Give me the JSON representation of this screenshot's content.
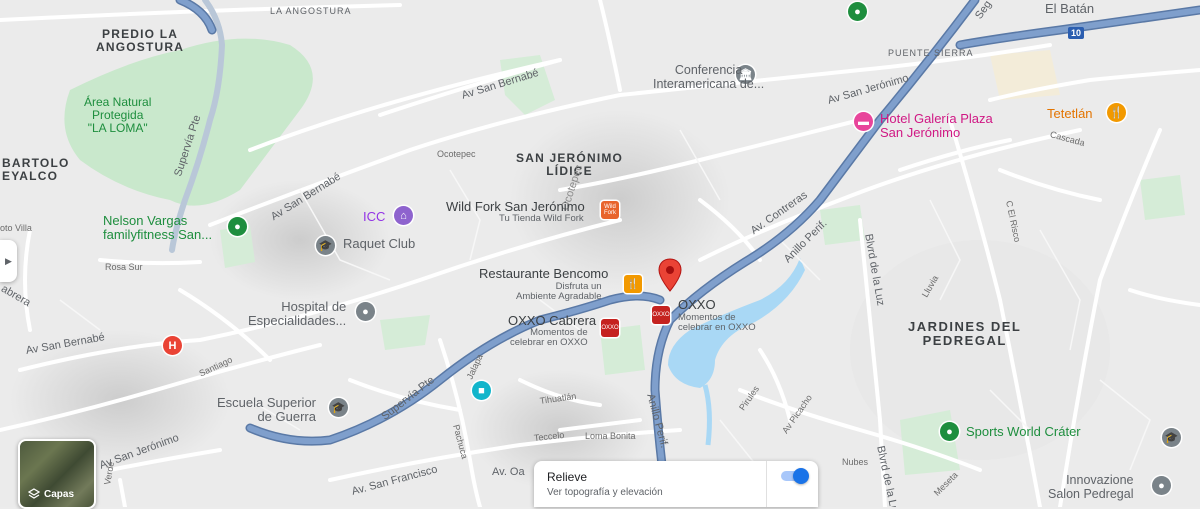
{
  "areas": {
    "predio_la_angostura": "PREDIO LA\nANGOSTURA",
    "la_angostura": "LA ANGOSTURA",
    "bartolo_ameyalco": "BARTOLO\nEYALCO",
    "san_jeronimo_lidice": "SAN JERÓNIMO\nLÍDICE",
    "jardines_del_pedregal": "JARDINES DEL\nPEDREGAL",
    "puente_sierra": "PUENTE SIERRA",
    "el_batan": "El Batán",
    "ocotepec": "Ocotepec",
    "area_natural": "Área Natural\nProtegida\n\"LA LOMA\""
  },
  "streets": {
    "av_san_bernabe_1": "Av San Bernabé",
    "av_san_bernabe_2": "Av San Bernabé",
    "av_san_bernabe_3": "Av San Bernabé",
    "av_san_jeronimo_1": "Av San Jerónimo",
    "av_san_jeronimo_2": "Av San Jerónimo",
    "supervia_pte_1": "Supervía Pte",
    "supervia_pte_2": "Supervía Pte",
    "av_contreras": "Av. Contreras",
    "anillo_perif_1": "Anillo Perif.",
    "anillo_perif_2": "Anillo Perif.",
    "blvrd_de_la_luz_1": "Blvrd de la Luz",
    "blvrd_de_la_luz_2": "Blvrd de la Luz",
    "av_san_francisco": "Av. San Francisco",
    "seg": "Seg",
    "cascada": "Cascada",
    "el_risco": "C El Risco",
    "lluvia": "Lluvia",
    "rosa_sur": "Rosa Sur",
    "santiago": "Santiago",
    "jalapa": "Jalapa",
    "pachuca": "Pachuca",
    "tihuatlan": "Tihuatlán",
    "teccelo": "Teccelo",
    "loma_bonita": "Loma Bonita",
    "pirules": "Pirules",
    "av_picacho": "Av Picacho",
    "nubes": "Nubes",
    "meseta": "Meseta",
    "coto_villa": "oto Villa",
    "abrera": "abrera",
    "ocotepec_street": "Ocotepec",
    "av_o": "Av. Oa",
    "verde": "Verde"
  },
  "pois": {
    "conferencia": "Conferencia\nInteramericana de...",
    "hotel_galeria": "Hotel Galería Plaza\nSan Jerónimo",
    "tetetlan": "Tetetlán",
    "nelson_vargas": "Nelson Vargas\nfamilyfitness San...",
    "icc": "ICC",
    "raquet_club": "Raquet Club",
    "wild_fork": "Wild Fork San Jerónimo",
    "wild_fork_sub": "Tu Tienda Wild Fork",
    "restaurante_bencomo": "Restaurante Bencomo",
    "restaurante_bencomo_sub": "Disfruta un\nAmbiente Agradable",
    "oxxo_1": "OXXO",
    "oxxo_1_sub": "Momentos de\ncelebrar en OXXO",
    "oxxo_cabrera": "OXXO Cabrera",
    "oxxo_cabrera_sub": "Momentos de\ncelebrar en OXXO",
    "hospital": "Hospital de\nEspecialidades...",
    "escuela": "Escuela Superior\nde Guerra",
    "sports_world": "Sports World Cráter",
    "innovacion": "Innovazione\nSalon Pedregal",
    "wild_fork_logo": "Wild\nFork",
    "oxxo_logo": "OXXO"
  },
  "highway_shield": "10",
  "relieve": {
    "title": "Relieve",
    "subtitle": "Ver topografía y elevación",
    "enabled": true
  },
  "layers_button": {
    "label": "Capas"
  },
  "colors": {
    "highway": "#6e90c0",
    "park": "#c5e5c9",
    "water": "#aadaff",
    "marker": "#ea4335",
    "oxxo": "#c5221f",
    "restaurant": "#f29900",
    "poi_gray": "#7a8389",
    "poi_green": "#1e8e3e",
    "hotel_pink": "#e8459b",
    "icc_violet": "#8e63ce"
  }
}
